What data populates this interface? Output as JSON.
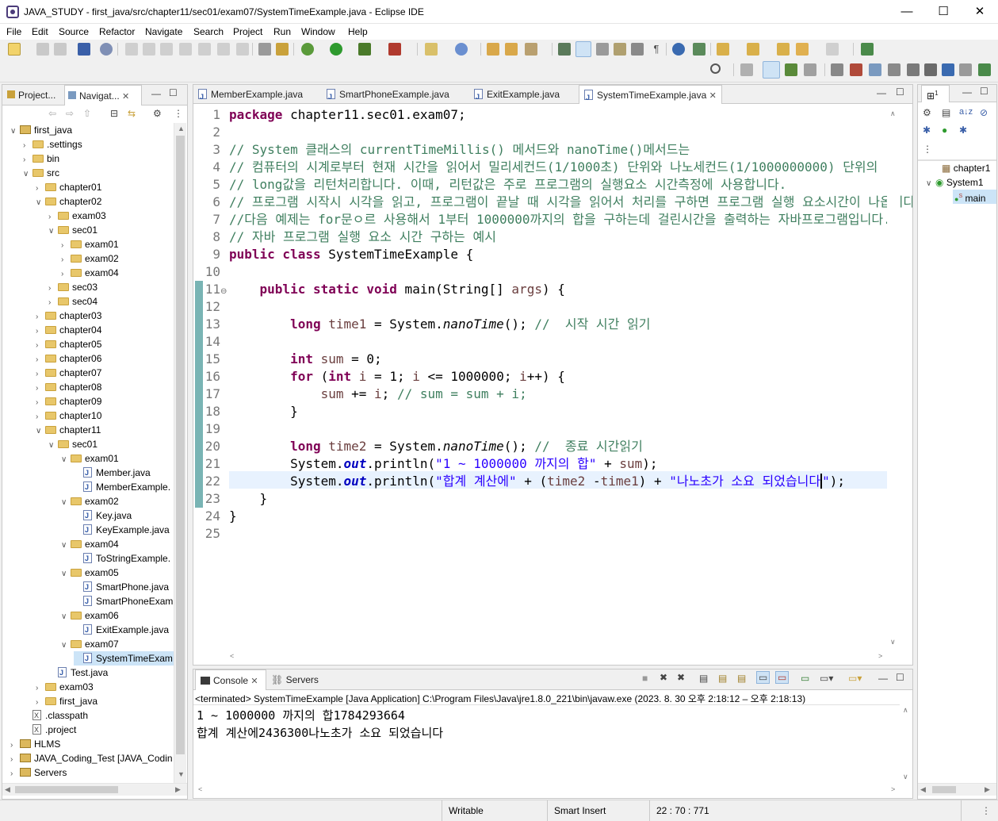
{
  "window": {
    "title": "JAVA_STUDY - first_java/src/chapter11/sec01/exam07/SystemTimeExample.java - Eclipse IDE",
    "minimize": "—",
    "maximize": "☐",
    "close": "✕"
  },
  "menu": [
    "File",
    "Edit",
    "Source",
    "Refactor",
    "Navigate",
    "Search",
    "Project",
    "Run",
    "Window",
    "Help"
  ],
  "left_view": {
    "tabs": [
      "Project...",
      "Navigat..."
    ],
    "tree": [
      {
        "label": "first_java",
        "icon": "project",
        "expanded": true
      },
      {
        "label": ".settings",
        "icon": "folder"
      },
      {
        "label": "bin",
        "icon": "folder"
      },
      {
        "label": "src",
        "icon": "folder",
        "expanded": true
      },
      {
        "label": "chapter01",
        "icon": "folder"
      },
      {
        "label": "chapter02",
        "icon": "folder",
        "expanded": true
      },
      {
        "label": "exam03",
        "icon": "folder"
      },
      {
        "label": "sec01",
        "icon": "folder",
        "expanded": true
      },
      {
        "label": "exam01",
        "icon": "folder"
      },
      {
        "label": "exam02",
        "icon": "folder"
      },
      {
        "label": "exam04",
        "icon": "folder"
      },
      {
        "label": "sec03",
        "icon": "folder"
      },
      {
        "label": "sec04",
        "icon": "folder"
      },
      {
        "label": "chapter03",
        "icon": "folder"
      },
      {
        "label": "chapter04",
        "icon": "folder"
      },
      {
        "label": "chapter05",
        "icon": "folder"
      },
      {
        "label": "chapter06",
        "icon": "folder"
      },
      {
        "label": "chapter07",
        "icon": "folder"
      },
      {
        "label": "chapter08",
        "icon": "folder"
      },
      {
        "label": "chapter09",
        "icon": "folder"
      },
      {
        "label": "chapter10",
        "icon": "folder"
      },
      {
        "label": "chapter11",
        "icon": "folder",
        "expanded": true
      },
      {
        "label": "sec01",
        "icon": "folder",
        "expanded": true
      },
      {
        "label": "exam01",
        "icon": "folder",
        "expanded": true
      },
      {
        "label": "Member.java",
        "icon": "java"
      },
      {
        "label": "MemberExample.",
        "icon": "java"
      },
      {
        "label": "exam02",
        "icon": "folder",
        "expanded": true
      },
      {
        "label": "Key.java",
        "icon": "java"
      },
      {
        "label": "KeyExample.java",
        "icon": "java"
      },
      {
        "label": "exam04",
        "icon": "folder",
        "expanded": true
      },
      {
        "label": "ToStringExample.",
        "icon": "java"
      },
      {
        "label": "exam05",
        "icon": "folder",
        "expanded": true
      },
      {
        "label": "SmartPhone.java",
        "icon": "java"
      },
      {
        "label": "SmartPhoneExam",
        "icon": "java"
      },
      {
        "label": "exam06",
        "icon": "folder",
        "expanded": true
      },
      {
        "label": "ExitExample.java",
        "icon": "java"
      },
      {
        "label": "exam07",
        "icon": "folder",
        "expanded": true
      },
      {
        "label": "SystemTimeExam",
        "icon": "java",
        "selected": true
      },
      {
        "label": "Test.java",
        "icon": "java"
      },
      {
        "label": "exam03",
        "icon": "folder"
      },
      {
        "label": "first_java",
        "icon": "folder"
      },
      {
        "label": ".classpath",
        "icon": "xml"
      },
      {
        "label": ".project",
        "icon": "xml"
      },
      {
        "label": "HLMS",
        "icon": "project"
      },
      {
        "label": "JAVA_Coding_Test [JAVA_Codin",
        "icon": "project"
      },
      {
        "label": "Servers",
        "icon": "project"
      }
    ]
  },
  "editor": {
    "tabs": [
      "MemberExample.java",
      "SmartPhoneExample.java",
      "ExitExample.java",
      "SystemTimeExample.java"
    ],
    "active_tab": 3,
    "lines": [
      "package chapter11.sec01.exam07;",
      "",
      "// System 클래스의 currentTimeMillis() 메서드와 nanoTime()메서드는",
      "// 컴퓨터의 시계로부터 현재 시간을 읽어서 밀리세컨드(1/1000초) 단위와 나노세컨드(1/1000000000) 단위의",
      "// long값을 리턴처리합니다. 이때, 리턴값은 주로 프로그램의 실행요소 시간측정에 사용합니다.",
      "// 프로그램 시작시 시각을 읽고, 프로그램이 끝날 때 시각을 읽어서 처리를 구하면 프로그램 실행 요소시간이 나옵니다.",
      "//다음 예제는 for문ㅇ르 사용해서 1부터 1000000까지의 합을 구하는데 걸린시간을 출력하는 자바프로그램입니다.",
      "// 자바 프로그램 실행 요소 시간 구하는 예시",
      "public class SystemTimeExample {",
      "",
      "    public static void main(String[] args) {",
      "",
      "        long time1 = System.nanoTime(); //  시작 시간 읽기",
      "",
      "        int sum = 0;",
      "        for (int i = 1; i <= 1000000; i++) {",
      "            sum += i; // sum = sum + i;",
      "        }",
      "",
      "        long time2 = System.nanoTime(); //  종료 시간읽기",
      "        System.out.println(\"1 ~ 1000000 까지의 합\" + sum);",
      "        System.out.println(\"합계 계산에\" + (time2 -time1) + \"나노초가 소요 되었습니다\");",
      "    }",
      "}",
      ""
    ],
    "current_line": 22
  },
  "right_view": {
    "items": [
      "chapter1",
      "System1",
      "main"
    ]
  },
  "console": {
    "tabs": [
      "Console",
      "Servers"
    ],
    "header": "<terminated> SystemTimeExample [Java Application] C:\\Program Files\\Java\\jre1.8.0_221\\bin\\javaw.exe  (2023. 8. 30 오후 2:18:12 – 오후 2:18:13)",
    "output": [
      "1 ~ 1000000 까지의 합1784293664",
      "합계 계산에2436300나노초가 소요 되었습니다"
    ]
  },
  "status": {
    "writable": "Writable",
    "insert_mode": "Smart Insert",
    "position": "22 : 70 : 771"
  },
  "colors": {
    "keyword": "#7f0055",
    "comment": "#3f7f5f",
    "string": "#2a00ff",
    "field": "#0000c0",
    "current_line": "#e8f2fe"
  }
}
